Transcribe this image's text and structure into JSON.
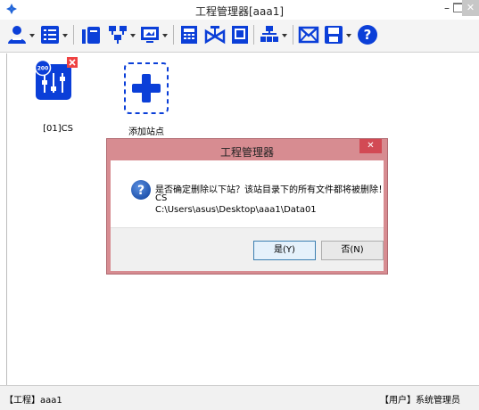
{
  "window": {
    "title": "工程管理器[aaa1]",
    "min_glyph": "–",
    "close_glyph": "✕"
  },
  "toolbar": {
    "buttons": [
      {
        "icon": "users-icon",
        "has_dropdown": true
      },
      {
        "icon": "list-icon",
        "has_dropdown": true
      },
      {
        "icon": "device-icon",
        "has_dropdown": false
      },
      {
        "icon": "network-icon",
        "has_dropdown": true
      },
      {
        "icon": "screen-icon",
        "has_dropdown": true
      },
      {
        "icon": "calculator-icon",
        "has_dropdown": false
      },
      {
        "icon": "valve-icon",
        "has_dropdown": false
      },
      {
        "icon": "display-icon",
        "has_dropdown": false
      },
      {
        "icon": "network-tree-icon",
        "has_dropdown": true
      },
      {
        "icon": "mail-icon",
        "has_dropdown": false
      },
      {
        "icon": "save-icon",
        "has_dropdown": true
      },
      {
        "icon": "help-icon",
        "has_dropdown": false
      }
    ]
  },
  "stations": [
    {
      "label": "[01]CS",
      "badge": "200"
    },
    {
      "label": "添加站点"
    }
  ],
  "dialog": {
    "title": "工程管理器",
    "close_glyph": "✕",
    "message_lines": [
      "是否确定删除以下站？该站目录下的所有文件都将被删除！",
      "CS",
      "C:\\Users\\asus\\Desktop\\aaa1\\Data01"
    ],
    "yes_label": "是(Y)",
    "no_label": "否(N)"
  },
  "status": {
    "project": "【工程】aaa1",
    "user": "【用户】系统管理员"
  },
  "colors": {
    "accent_blue": "#0b3fd8",
    "toolbar_blue": "#2a63c7",
    "dialog_frame": "#d78c91",
    "close_red": "#d24a54"
  }
}
